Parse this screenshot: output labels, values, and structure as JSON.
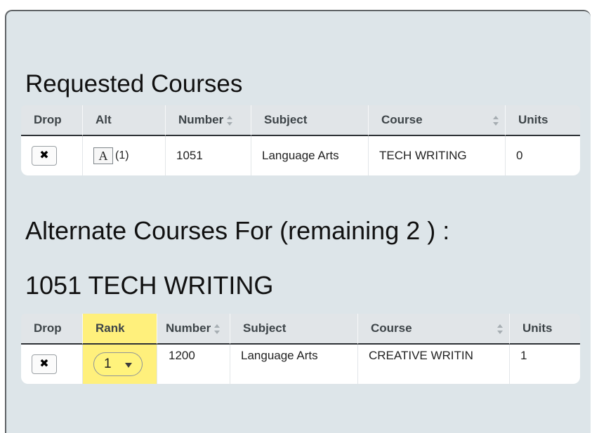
{
  "requested": {
    "title": "Requested Courses",
    "headers": {
      "drop": "Drop",
      "alt": "Alt",
      "number": "Number",
      "subject": "Subject",
      "course": "Course",
      "units": "Units"
    },
    "row": {
      "drop_icon": "close-icon",
      "drop_symbol": "✖",
      "alt_label": "A",
      "alt_count": "(1)",
      "number": "1051",
      "subject": "Language Arts",
      "course": "TECH WRITING",
      "units": "0"
    }
  },
  "alternate": {
    "title": "Alternate Courses For (remaining 2 ) :",
    "course_title": "1051 TECH WRITING",
    "headers": {
      "drop": "Drop",
      "rank": "Rank",
      "number": "Number",
      "subject": "Subject",
      "course": "Course",
      "units": "Units"
    },
    "row": {
      "drop_icon": "close-icon",
      "drop_symbol": "✖",
      "rank": "1",
      "number": "1200",
      "subject": "Language Arts",
      "course": "CREATIVE WRITIN",
      "units": "1"
    }
  },
  "colors": {
    "panel_background": "#dde5e9",
    "highlight": "#fff07c",
    "header_background": "#e1e5e8"
  }
}
